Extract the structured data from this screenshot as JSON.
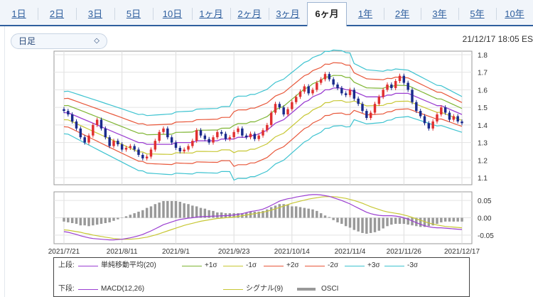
{
  "tabs": [
    {
      "label": "1日",
      "active": false
    },
    {
      "label": "2日",
      "active": false
    },
    {
      "label": "3日",
      "active": false
    },
    {
      "label": "5日",
      "active": false
    },
    {
      "label": "10日",
      "active": false
    },
    {
      "label": "1ヶ月",
      "active": false
    },
    {
      "label": "2ヶ月",
      "active": false
    },
    {
      "label": "3ヶ月",
      "active": false
    },
    {
      "label": "6ヶ月",
      "active": true
    },
    {
      "label": "1年",
      "active": false
    },
    {
      "label": "2年",
      "active": false
    },
    {
      "label": "3年",
      "active": false
    },
    {
      "label": "5年",
      "active": false
    },
    {
      "label": "10年",
      "active": false
    }
  ],
  "toolbar": {
    "period_select": "日足",
    "timestamp": "21/12/17 18:05 ES"
  },
  "chart_data": [
    {
      "type": "line",
      "panel": "upper",
      "x_labels": [
        "2021/7/21",
        "2021/8/11",
        "2021/9/1",
        "2021/9/23",
        "2021/10/14",
        "2021/11/4",
        "2021/11/26",
        "2021/12/17"
      ],
      "y_ticks": [
        1.1,
        1.2,
        1.3,
        1.4,
        1.5,
        1.6,
        1.7,
        1.8
      ],
      "ylim": [
        1.06,
        1.82
      ],
      "grid": true,
      "candlesticks": {
        "colors": {
          "up": "#e03030",
          "down": "#1a2a8c"
        },
        "close": [
          1.48,
          1.46,
          1.42,
          1.38,
          1.33,
          1.3,
          1.34,
          1.4,
          1.43,
          1.38,
          1.33,
          1.28,
          1.31,
          1.29,
          1.26,
          1.27,
          1.28,
          1.26,
          1.23,
          1.21,
          1.22,
          1.26,
          1.31,
          1.36,
          1.38,
          1.33,
          1.3,
          1.27,
          1.25,
          1.26,
          1.28,
          1.31,
          1.37,
          1.34,
          1.32,
          1.3,
          1.33,
          1.36,
          1.35,
          1.32,
          1.33,
          1.36,
          1.38,
          1.34,
          1.33,
          1.35,
          1.32,
          1.34,
          1.37,
          1.4,
          1.47,
          1.52,
          1.5,
          1.46,
          1.49,
          1.53,
          1.56,
          1.59,
          1.62,
          1.58,
          1.6,
          1.64,
          1.66,
          1.69,
          1.66,
          1.63,
          1.61,
          1.58,
          1.57,
          1.6,
          1.55,
          1.52,
          1.48,
          1.44,
          1.47,
          1.52,
          1.56,
          1.6,
          1.63,
          1.61,
          1.65,
          1.68,
          1.64,
          1.6,
          1.53,
          1.48,
          1.45,
          1.41,
          1.38,
          1.42,
          1.46,
          1.5,
          1.47,
          1.43,
          1.45,
          1.42,
          1.41
        ]
      },
      "series": [
        {
          "name": "単純移動平均(20)",
          "color": "#9b3fd1",
          "values": [
            1.47,
            1.47,
            1.46,
            1.45,
            1.44,
            1.43,
            1.42,
            1.41,
            1.4,
            1.39,
            1.38,
            1.37,
            1.36,
            1.35,
            1.34,
            1.33,
            1.32,
            1.31,
            1.3,
            1.3,
            1.29,
            1.29,
            1.29,
            1.29,
            1.29,
            1.29,
            1.29,
            1.3,
            1.3,
            1.3,
            1.3,
            1.3,
            1.31,
            1.31,
            1.31,
            1.31,
            1.31,
            1.31,
            1.32,
            1.32,
            1.32,
            1.32,
            1.33,
            1.33,
            1.33,
            1.34,
            1.34,
            1.35,
            1.36,
            1.37,
            1.39,
            1.41,
            1.42,
            1.43,
            1.45,
            1.47,
            1.49,
            1.51,
            1.53,
            1.54,
            1.56,
            1.57,
            1.58,
            1.6,
            1.6,
            1.61,
            1.61,
            1.61,
            1.6,
            1.6,
            1.59,
            1.58,
            1.57,
            1.56,
            1.56,
            1.56,
            1.56,
            1.56,
            1.57,
            1.57,
            1.58,
            1.58,
            1.58,
            1.58,
            1.57,
            1.56,
            1.55,
            1.54,
            1.53,
            1.52,
            1.51,
            1.51,
            1.5,
            1.49,
            1.48,
            1.47,
            1.46
          ]
        },
        {
          "name": "+1σ",
          "color": "#7fb533",
          "offset": 0.04
        },
        {
          "name": "-1σ",
          "color": "#c7c734",
          "offset": -0.04
        },
        {
          "name": "+2σ",
          "color": "#e8573a",
          "offset": 0.08
        },
        {
          "name": "-2σ",
          "color": "#e8573a",
          "offset": -0.08
        },
        {
          "name": "+3σ",
          "color": "#3ec3d0",
          "offset": 0.12
        },
        {
          "name": "-3σ",
          "color": "#3ec3d0",
          "offset": -0.12
        }
      ]
    },
    {
      "type": "line",
      "panel": "lower",
      "y_ticks": [
        0.05,
        0.0,
        -0.05
      ],
      "ylim": [
        -0.075,
        0.075
      ],
      "grid": true,
      "series": [
        {
          "name": "MACD(12,26)",
          "color": "#9b3fd1",
          "values": [
            -0.04,
            -0.042,
            -0.045,
            -0.048,
            -0.052,
            -0.055,
            -0.058,
            -0.06,
            -0.061,
            -0.062,
            -0.063,
            -0.064,
            -0.064,
            -0.063,
            -0.062,
            -0.06,
            -0.058,
            -0.055,
            -0.052,
            -0.048,
            -0.043,
            -0.038,
            -0.032,
            -0.026,
            -0.02,
            -0.016,
            -0.012,
            -0.008,
            -0.005,
            -0.003,
            -0.001,
            0.0,
            0.002,
            0.003,
            0.004,
            0.004,
            0.005,
            0.005,
            0.006,
            0.006,
            0.007,
            0.008,
            0.01,
            0.012,
            0.015,
            0.018,
            0.02,
            0.022,
            0.025,
            0.03,
            0.036,
            0.042,
            0.048,
            0.052,
            0.055,
            0.057,
            0.06,
            0.062,
            0.064,
            0.066,
            0.067,
            0.067,
            0.066,
            0.064,
            0.062,
            0.058,
            0.054,
            0.05,
            0.045,
            0.04,
            0.034,
            0.028,
            0.022,
            0.016,
            0.012,
            0.009,
            0.007,
            0.006,
            0.006,
            0.006,
            0.005,
            0.003,
            0.0,
            -0.004,
            -0.009,
            -0.014,
            -0.019,
            -0.023,
            -0.026,
            -0.028,
            -0.029,
            -0.029,
            -0.03,
            -0.031,
            -0.032,
            -0.033,
            -0.034
          ]
        },
        {
          "name": "シグナル(9)",
          "color": "#c7c734",
          "values": [
            -0.035,
            -0.036,
            -0.038,
            -0.04,
            -0.042,
            -0.045,
            -0.047,
            -0.05,
            -0.052,
            -0.054,
            -0.056,
            -0.058,
            -0.06,
            -0.061,
            -0.062,
            -0.062,
            -0.062,
            -0.061,
            -0.06,
            -0.058,
            -0.056,
            -0.053,
            -0.05,
            -0.046,
            -0.042,
            -0.038,
            -0.034,
            -0.03,
            -0.026,
            -0.022,
            -0.019,
            -0.016,
            -0.013,
            -0.01,
            -0.008,
            -0.006,
            -0.004,
            -0.002,
            -0.001,
            0.0,
            0.001,
            0.002,
            0.004,
            0.006,
            0.008,
            0.01,
            0.012,
            0.014,
            0.016,
            0.019,
            0.022,
            0.026,
            0.03,
            0.034,
            0.038,
            0.042,
            0.045,
            0.048,
            0.051,
            0.054,
            0.056,
            0.058,
            0.06,
            0.061,
            0.061,
            0.061,
            0.06,
            0.058,
            0.056,
            0.053,
            0.05,
            0.046,
            0.042,
            0.037,
            0.032,
            0.028,
            0.024,
            0.02,
            0.017,
            0.015,
            0.013,
            0.011,
            0.008,
            0.005,
            0.001,
            -0.003,
            -0.007,
            -0.011,
            -0.015,
            -0.018,
            -0.021,
            -0.023,
            -0.025,
            -0.026,
            -0.027,
            -0.028,
            -0.029
          ]
        },
        {
          "name": "OSCI",
          "color": "#999999",
          "type": "bar"
        }
      ]
    }
  ],
  "legend": {
    "upper_label": "上段:",
    "lower_label": "下段:",
    "upper_items": [
      {
        "name": "単純移動平均(20)",
        "color": "#9b3fd1"
      },
      {
        "name": "+1σ",
        "color": "#7fb533"
      },
      {
        "name": "-1σ",
        "color": "#c7c734"
      },
      {
        "name": "+2σ",
        "color": "#e8573a"
      },
      {
        "name": "-2σ",
        "color": "#e8573a"
      },
      {
        "name": "+3σ",
        "color": "#3ec3d0"
      },
      {
        "name": "-3σ",
        "color": "#3ec3d0"
      }
    ],
    "lower_items": [
      {
        "name": "MACD(12,26)",
        "color": "#9b3fd1"
      },
      {
        "name": "シグナル(9)",
        "color": "#c7c734"
      },
      {
        "name": "OSCI",
        "color": "#999999"
      }
    ]
  }
}
